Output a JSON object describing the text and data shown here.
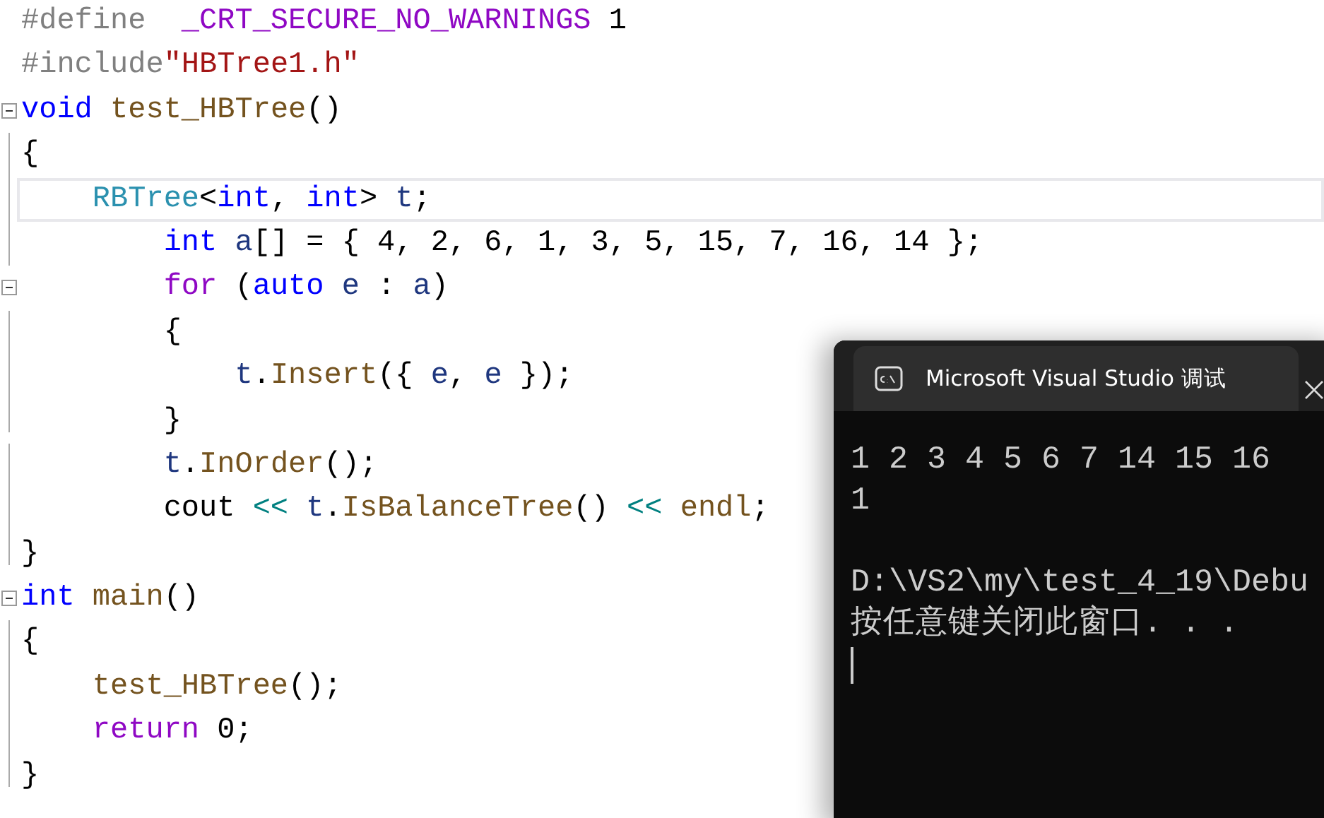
{
  "editor": {
    "lines": [
      {
        "kind": "plain",
        "current": false,
        "tokens": [
          {
            "kind": "directive",
            "text": "#define  "
          },
          {
            "kind": "macro",
            "text": "_CRT_SECURE_NO_WARNINGS"
          },
          {
            "kind": "plain",
            "text": " 1"
          }
        ]
      },
      {
        "kind": "plain",
        "current": false,
        "tokens": [
          {
            "kind": "directive",
            "text": "#include"
          },
          {
            "kind": "string",
            "text": "\"HBTree1.h\""
          }
        ]
      },
      {
        "kind": "foldstart",
        "current": false,
        "tokens": [
          {
            "kind": "keyword",
            "text": "void"
          },
          {
            "kind": "function",
            "text": " test_HBTree"
          },
          {
            "kind": "plain",
            "text": "()"
          }
        ]
      },
      {
        "kind": "foldbody",
        "current": false,
        "tokens": [
          {
            "kind": "plain",
            "text": "{"
          }
        ]
      },
      {
        "kind": "foldbody",
        "current": true,
        "tokens": [
          {
            "kind": "type",
            "text": "    RBTree"
          },
          {
            "kind": "plain",
            "text": "<"
          },
          {
            "kind": "keyword",
            "text": "int"
          },
          {
            "kind": "plain",
            "text": ", "
          },
          {
            "kind": "keyword",
            "text": "int"
          },
          {
            "kind": "plain",
            "text": "> "
          },
          {
            "kind": "variable",
            "text": "t"
          },
          {
            "kind": "plain",
            "text": ";"
          }
        ]
      },
      {
        "kind": "foldbody",
        "current": false,
        "tokens": [
          {
            "kind": "keyword",
            "text": "        int"
          },
          {
            "kind": "variable",
            "text": " a"
          },
          {
            "kind": "plain",
            "text": "[] = { 4, 2, 6, 1, 3, 5, 15, 7, 16, 14 };"
          }
        ]
      },
      {
        "kind": "foldstart",
        "current": false,
        "tokens": [
          {
            "kind": "control",
            "text": "        for"
          },
          {
            "kind": "plain",
            "text": " ("
          },
          {
            "kind": "keyword",
            "text": "auto"
          },
          {
            "kind": "variable",
            "text": " e"
          },
          {
            "kind": "plain",
            "text": " : "
          },
          {
            "kind": "variable",
            "text": "a"
          },
          {
            "kind": "plain",
            "text": ")"
          }
        ]
      },
      {
        "kind": "foldbody",
        "current": false,
        "tokens": [
          {
            "kind": "plain",
            "text": "        {"
          }
        ]
      },
      {
        "kind": "foldbody",
        "current": false,
        "tokens": [
          {
            "kind": "variable",
            "text": "            t"
          },
          {
            "kind": "plain",
            "text": "."
          },
          {
            "kind": "function",
            "text": "Insert"
          },
          {
            "kind": "plain",
            "text": "({ "
          },
          {
            "kind": "variable",
            "text": "e"
          },
          {
            "kind": "plain",
            "text": ", "
          },
          {
            "kind": "variable",
            "text": "e"
          },
          {
            "kind": "plain",
            "text": " });"
          }
        ]
      },
      {
        "kind": "foldend",
        "current": false,
        "tokens": [
          {
            "kind": "plain",
            "text": "        }"
          }
        ]
      },
      {
        "kind": "foldbody",
        "current": false,
        "tokens": [
          {
            "kind": "variable",
            "text": "        t"
          },
          {
            "kind": "plain",
            "text": "."
          },
          {
            "kind": "function",
            "text": "InOrder"
          },
          {
            "kind": "plain",
            "text": "();"
          }
        ]
      },
      {
        "kind": "foldbody",
        "current": false,
        "tokens": [
          {
            "kind": "plain",
            "text": "        cout "
          },
          {
            "kind": "operator",
            "text": "<<"
          },
          {
            "kind": "variable",
            "text": " t"
          },
          {
            "kind": "plain",
            "text": "."
          },
          {
            "kind": "function",
            "text": "IsBalanceTree"
          },
          {
            "kind": "plain",
            "text": "() "
          },
          {
            "kind": "operator",
            "text": "<<"
          },
          {
            "kind": "function",
            "text": " endl"
          },
          {
            "kind": "plain",
            "text": ";"
          }
        ]
      },
      {
        "kind": "foldend",
        "current": false,
        "tokens": [
          {
            "kind": "plain",
            "text": "}"
          }
        ]
      },
      {
        "kind": "foldstart",
        "current": false,
        "tokens": [
          {
            "kind": "keyword",
            "text": "int"
          },
          {
            "kind": "function",
            "text": " main"
          },
          {
            "kind": "plain",
            "text": "()"
          }
        ]
      },
      {
        "kind": "foldbody",
        "current": false,
        "tokens": [
          {
            "kind": "plain",
            "text": "{"
          }
        ]
      },
      {
        "kind": "foldbody",
        "current": false,
        "tokens": [
          {
            "kind": "function",
            "text": "    test_HBTree"
          },
          {
            "kind": "plain",
            "text": "();"
          }
        ]
      },
      {
        "kind": "foldbody",
        "current": false,
        "tokens": [
          {
            "kind": "control",
            "text": "    return"
          },
          {
            "kind": "plain",
            "text": " 0;"
          }
        ]
      },
      {
        "kind": "foldend",
        "current": false,
        "tokens": [
          {
            "kind": "plain",
            "text": "}"
          }
        ]
      }
    ]
  },
  "console": {
    "title": "Microsoft Visual Studio 调试",
    "output": [
      "1 2 3 4 5 6 7 14 15 16",
      "1"
    ],
    "prompt": [
      "D:\\VS2\\my\\test_4_19\\Debu",
      "按任意键关闭此窗口. . ."
    ]
  }
}
